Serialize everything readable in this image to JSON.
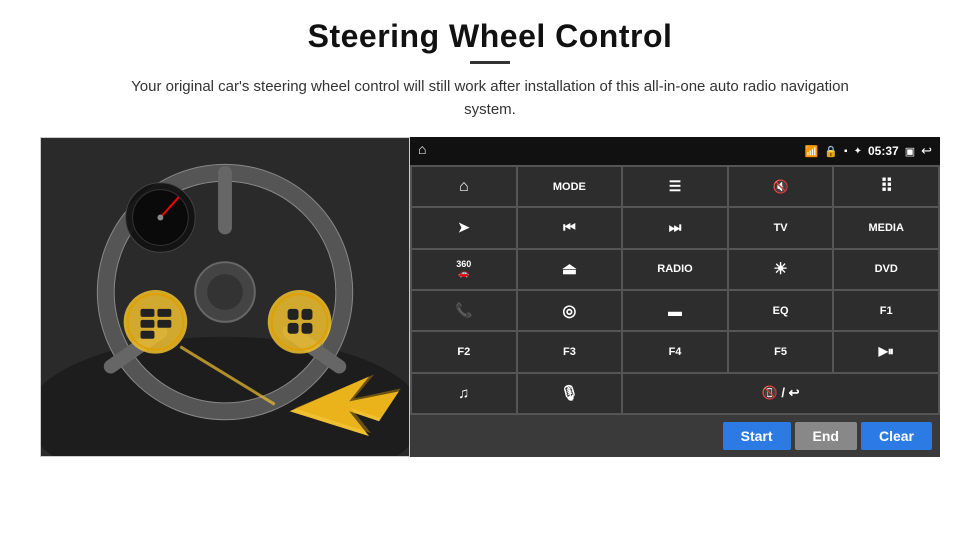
{
  "page": {
    "title": "Steering Wheel Control",
    "subtitle": "Your original car's steering wheel control will still work after installation of this all-in-one auto radio navigation system."
  },
  "status_bar": {
    "time": "05:37",
    "icons": [
      "wifi",
      "lock",
      "sd",
      "bluetooth",
      "recent",
      "back"
    ]
  },
  "grid_buttons": [
    {
      "id": "home",
      "icon": "home",
      "label": "",
      "type": "icon"
    },
    {
      "id": "mode",
      "icon": "",
      "label": "MODE",
      "type": "text"
    },
    {
      "id": "list",
      "icon": "list",
      "label": "",
      "type": "icon"
    },
    {
      "id": "vol-mute",
      "icon": "vol-mute",
      "label": "",
      "type": "icon"
    },
    {
      "id": "apps",
      "icon": "apps",
      "label": "",
      "type": "icon"
    },
    {
      "id": "nav",
      "icon": "nav",
      "label": "",
      "type": "icon"
    },
    {
      "id": "prev",
      "icon": "prev",
      "label": "",
      "type": "icon"
    },
    {
      "id": "next",
      "icon": "next",
      "label": "",
      "type": "icon"
    },
    {
      "id": "tv",
      "icon": "",
      "label": "TV",
      "type": "text"
    },
    {
      "id": "media",
      "icon": "",
      "label": "MEDIA",
      "type": "text"
    },
    {
      "id": "cam360",
      "icon": "360",
      "label": "",
      "type": "icon"
    },
    {
      "id": "eject",
      "icon": "eject",
      "label": "",
      "type": "icon"
    },
    {
      "id": "radio",
      "icon": "",
      "label": "RADIO",
      "type": "text"
    },
    {
      "id": "brightness",
      "icon": "brightness",
      "label": "",
      "type": "icon"
    },
    {
      "id": "dvd",
      "icon": "",
      "label": "DVD",
      "type": "text"
    },
    {
      "id": "phone",
      "icon": "phone",
      "label": "",
      "type": "icon"
    },
    {
      "id": "globe",
      "icon": "globe",
      "label": "",
      "type": "icon"
    },
    {
      "id": "screen",
      "icon": "screen",
      "label": "",
      "type": "icon"
    },
    {
      "id": "eq",
      "icon": "",
      "label": "EQ",
      "type": "text"
    },
    {
      "id": "f1",
      "icon": "",
      "label": "F1",
      "type": "text"
    },
    {
      "id": "f2",
      "icon": "",
      "label": "F2",
      "type": "text"
    },
    {
      "id": "f3",
      "icon": "",
      "label": "F3",
      "type": "text"
    },
    {
      "id": "f4",
      "icon": "",
      "label": "F4",
      "type": "text"
    },
    {
      "id": "f5",
      "icon": "",
      "label": "F5",
      "type": "text"
    },
    {
      "id": "play-pause",
      "icon": "play-pause",
      "label": "",
      "type": "icon"
    },
    {
      "id": "music",
      "icon": "music",
      "label": "",
      "type": "icon"
    },
    {
      "id": "mic",
      "icon": "mic",
      "label": "",
      "type": "icon"
    },
    {
      "id": "hangup",
      "icon": "hangup",
      "label": "",
      "type": "icon",
      "wide": true
    }
  ],
  "action_buttons": {
    "start": "Start",
    "end": "End",
    "clear": "Clear"
  }
}
